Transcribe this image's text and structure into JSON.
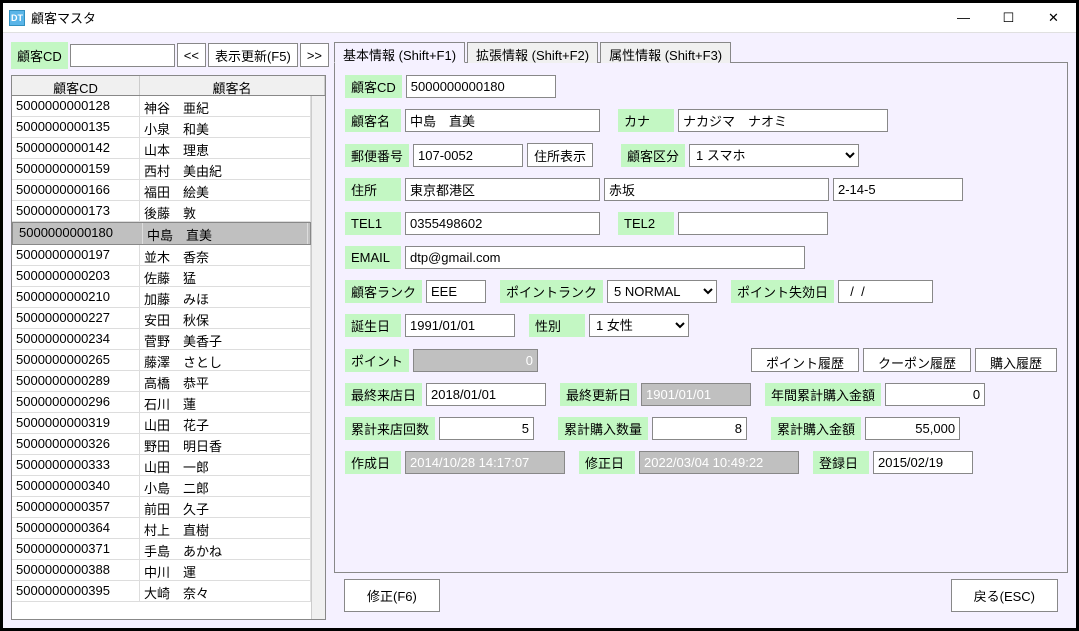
{
  "window": {
    "title": "顧客マスタ",
    "icon_text": "DT"
  },
  "win_buttons": {
    "min": "—",
    "max": "☐",
    "close": "✕"
  },
  "search": {
    "label": "顧客CD",
    "value": "",
    "prev": "<<",
    "refresh": "表示更新(F5)",
    "next": ">>"
  },
  "grid": {
    "headers": {
      "cd": "顧客CD",
      "name": "顧客名"
    },
    "selected_cd": "5000000000180",
    "rows": [
      {
        "cd": "5000000000128",
        "name": "神谷　亜紀"
      },
      {
        "cd": "5000000000135",
        "name": "小泉　和美"
      },
      {
        "cd": "5000000000142",
        "name": "山本　理恵"
      },
      {
        "cd": "5000000000159",
        "name": "西村　美由紀"
      },
      {
        "cd": "5000000000166",
        "name": "福田　絵美"
      },
      {
        "cd": "5000000000173",
        "name": "後藤　敦"
      },
      {
        "cd": "5000000000180",
        "name": "中島　直美"
      },
      {
        "cd": "5000000000197",
        "name": "並木　香奈"
      },
      {
        "cd": "5000000000203",
        "name": "佐藤　猛"
      },
      {
        "cd": "5000000000210",
        "name": "加藤　みほ"
      },
      {
        "cd": "5000000000227",
        "name": "安田　秋保"
      },
      {
        "cd": "5000000000234",
        "name": "菅野　美香子"
      },
      {
        "cd": "5000000000265",
        "name": "藤澤　さとし"
      },
      {
        "cd": "5000000000289",
        "name": "高橋　恭平"
      },
      {
        "cd": "5000000000296",
        "name": "石川　蓮"
      },
      {
        "cd": "5000000000319",
        "name": "山田　花子"
      },
      {
        "cd": "5000000000326",
        "name": "野田　明日香"
      },
      {
        "cd": "5000000000333",
        "name": "山田　一郎"
      },
      {
        "cd": "5000000000340",
        "name": "小島　二郎"
      },
      {
        "cd": "5000000000357",
        "name": "前田　久子"
      },
      {
        "cd": "5000000000364",
        "name": "村上　直樹"
      },
      {
        "cd": "5000000000371",
        "name": "手島　あかね"
      },
      {
        "cd": "5000000000388",
        "name": "中川　運"
      },
      {
        "cd": "5000000000395",
        "name": "大崎　奈々"
      }
    ]
  },
  "tabs": [
    "基本情報 (Shift+F1)",
    "拡張情報 (Shift+F2)",
    "属性情報 (Shift+F3)"
  ],
  "form": {
    "cd_label": "顧客CD",
    "cd": "5000000000180",
    "name_label": "顧客名",
    "name": "中島　直美",
    "kana_label": "カナ",
    "kana": "ナカジマ　ナオミ",
    "zip_label": "郵便番号",
    "zip": "107-0052",
    "zip_btn": "住所表示",
    "kubun_label": "顧客区分",
    "kubun": "1 スマホ",
    "addr_label": "住所",
    "addr1": "東京都港区",
    "addr2": "赤坂",
    "addr3": "2-14-5",
    "tel1_label": "TEL1",
    "tel1": "0355498602",
    "tel2_label": "TEL2",
    "tel2": "",
    "email_label": "EMAIL",
    "email": "dtp@gmail.com",
    "rank_label": "顧客ランク",
    "rank": "EEE",
    "prank_label": "ポイントランク",
    "prank": "5 NORMAL",
    "pexp_label": "ポイント失効日",
    "pexp": "  /  /  ",
    "bday_label": "誕生日",
    "bday": "1991/01/01",
    "sex_label": "性別",
    "sex": "1 女性",
    "point_label": "ポイント",
    "point": "0",
    "phist_btn": "ポイント履歴",
    "chist_btn": "クーポン履歴",
    "buyhist_btn": "購入履歴",
    "lvisit_label": "最終来店日",
    "lvisit": "2018/01/01",
    "lupd_label": "最終更新日",
    "lupd": "1901/01/01",
    "ytotal_label": "年間累計購入金額",
    "ytotal": "0",
    "vcount_label": "累計来店回数",
    "vcount": "5",
    "bcount_label": "累計購入数量",
    "bcount": "8",
    "btotal_label": "累計購入金額",
    "btotal": "55,000",
    "created_label": "作成日",
    "created": "2014/10/28 14:17:07",
    "modified_label": "修正日",
    "modified": "2022/03/04 10:49:22",
    "registered_label": "登録日",
    "registered": "2015/02/19"
  },
  "bottom": {
    "edit": "修正(F6)",
    "back": "戻る(ESC)"
  }
}
